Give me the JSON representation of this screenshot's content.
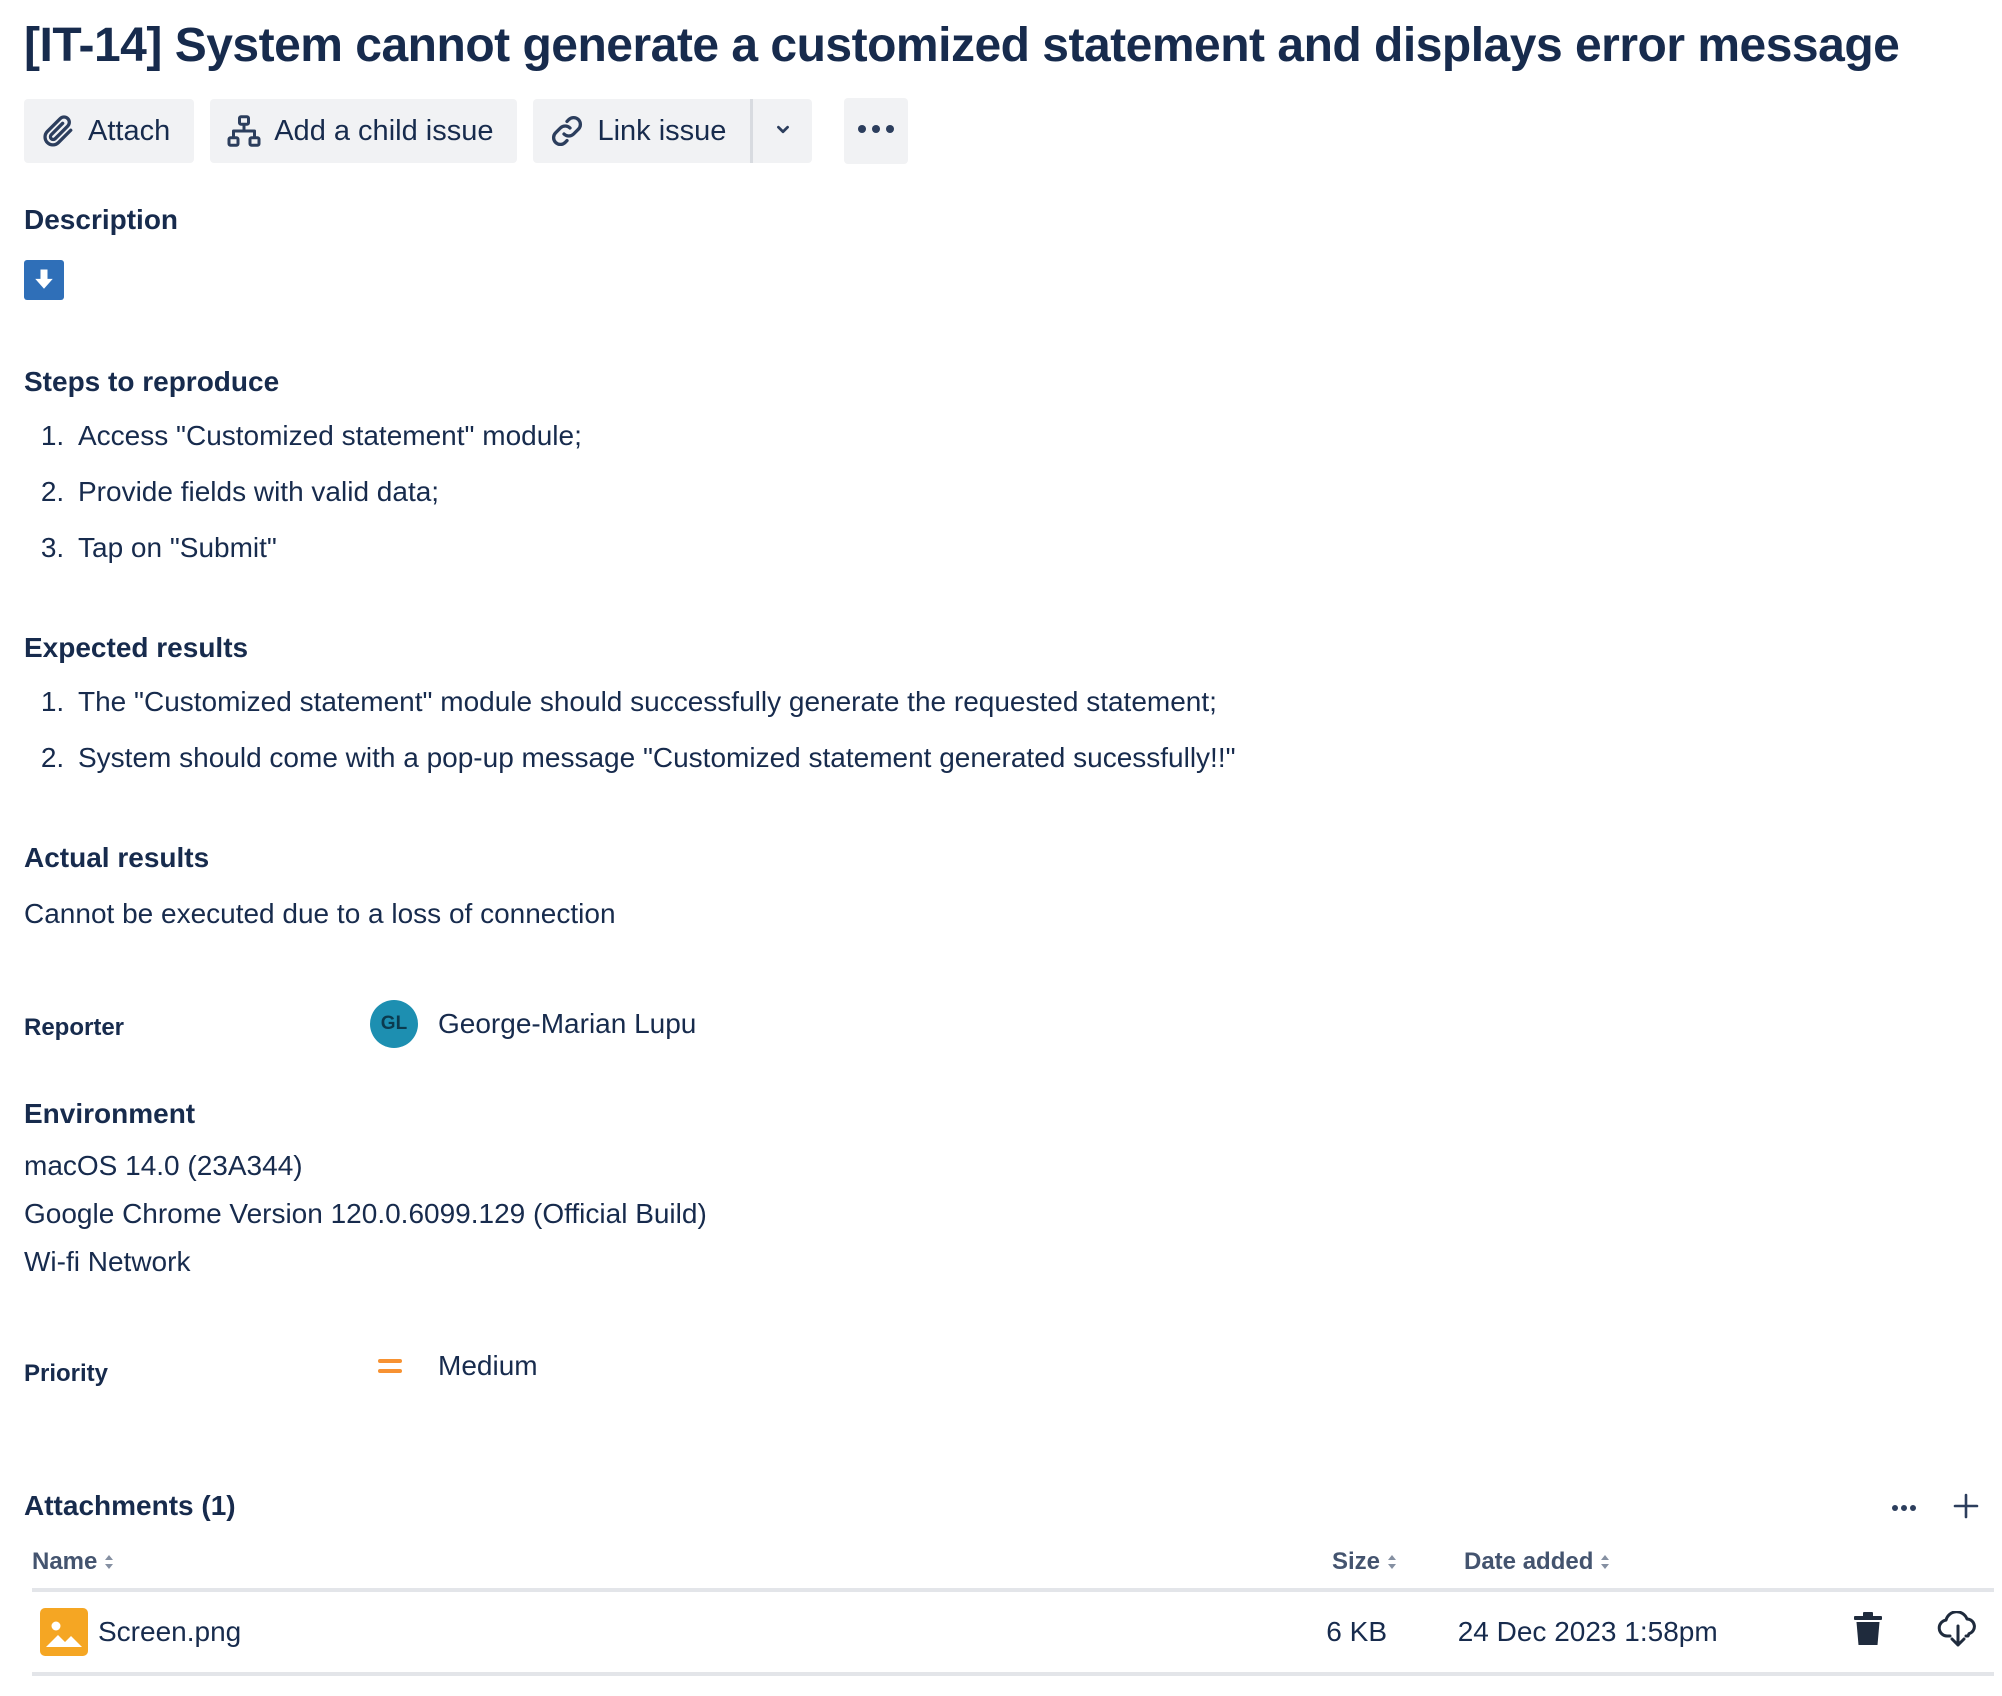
{
  "issue": {
    "title": "[IT-14] System cannot generate a customized statement and displays error message"
  },
  "toolbar": {
    "attach_label": "Attach",
    "child_issue_label": "Add a child issue",
    "link_issue_label": "Link issue"
  },
  "description": {
    "heading": "Description"
  },
  "steps": {
    "heading": "Steps to reproduce",
    "items": [
      "Access \"Customized statement\" module;",
      "Provide fields with valid data;",
      "Tap on \"Submit\""
    ]
  },
  "expected": {
    "heading": "Expected results",
    "items": [
      "The \"Customized statement\" module should successfully generate the requested statement;",
      "System should come with a pop-up message \"Customized statement generated sucessfully!!\""
    ]
  },
  "actual": {
    "heading": "Actual results",
    "text": "Cannot be executed due to a loss of connection"
  },
  "reporter": {
    "label": "Reporter",
    "initials": "GL",
    "name": "George-Marian Lupu",
    "avatar_color": "#1d8fb1"
  },
  "environment": {
    "heading": "Environment",
    "lines": [
      "macOS 14.0 (23A344)",
      "Google Chrome Version 120.0.6099.129 (Official Build)",
      "Wi-fi Network"
    ]
  },
  "priority": {
    "label": "Priority",
    "value": "Medium",
    "icon": "priority-medium-icon",
    "color": "#f79232"
  },
  "attachments": {
    "heading": "Attachments (1)",
    "columns": {
      "name": "Name",
      "size": "Size",
      "date": "Date added"
    },
    "rows": [
      {
        "name": "Screen.png",
        "size": "6 KB",
        "date": "24 Dec 2023 1:58pm",
        "icon": "image-file-icon"
      }
    ]
  },
  "colors": {
    "text": "#172b4d",
    "button_bg": "#f1f2f4",
    "accent_blue": "#2f6fb8",
    "file_icon": "#f5a623"
  }
}
